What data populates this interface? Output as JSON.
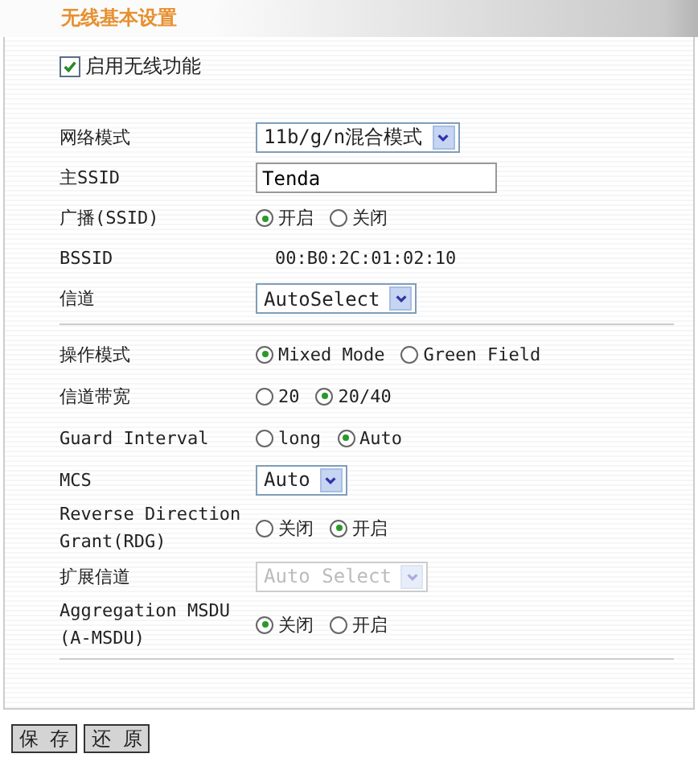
{
  "title": "无线基本设置",
  "enable": {
    "label": "启用无线功能",
    "checked": true
  },
  "sections": [
    {
      "rows": [
        {
          "kind": "select",
          "label": "网络模式",
          "value": "11b/g/n混合模式",
          "disabled": false
        },
        {
          "kind": "text",
          "label": "主SSID",
          "value": "Tenda"
        },
        {
          "kind": "radio",
          "label": "广播(SSID)",
          "options": [
            {
              "label": "开启",
              "selected": true
            },
            {
              "label": "关闭",
              "selected": false
            }
          ]
        },
        {
          "kind": "static",
          "label": "BSSID",
          "value": "00:B0:2C:01:02:10"
        },
        {
          "kind": "select",
          "label": "信道",
          "value": "AutoSelect",
          "disabled": false
        }
      ]
    },
    {
      "rows": [
        {
          "kind": "radio",
          "label": "操作模式",
          "options": [
            {
              "label": "Mixed Mode",
              "selected": true
            },
            {
              "label": "Green Field",
              "selected": false
            }
          ]
        },
        {
          "kind": "radio",
          "label": "信道带宽",
          "options": [
            {
              "label": "20",
              "selected": false
            },
            {
              "label": "20/40",
              "selected": true
            }
          ]
        },
        {
          "kind": "radio",
          "label": "Guard Interval",
          "options": [
            {
              "label": "long",
              "selected": false
            },
            {
              "label": "Auto",
              "selected": true
            }
          ]
        },
        {
          "kind": "select",
          "label": "MCS",
          "value": "Auto",
          "disabled": false
        },
        {
          "kind": "radio",
          "label": "Reverse Direction Grant(RDG)",
          "options": [
            {
              "label": "关闭",
              "selected": false
            },
            {
              "label": "开启",
              "selected": true
            }
          ]
        },
        {
          "kind": "select",
          "label": "扩展信道",
          "value": "Auto Select",
          "disabled": true
        },
        {
          "kind": "radio",
          "label": "Aggregation MSDU (A-MSDU)",
          "options": [
            {
              "label": "关闭",
              "selected": true
            },
            {
              "label": "开启",
              "selected": false
            }
          ]
        }
      ]
    }
  ],
  "buttons": [
    "保 存",
    "还 原"
  ]
}
